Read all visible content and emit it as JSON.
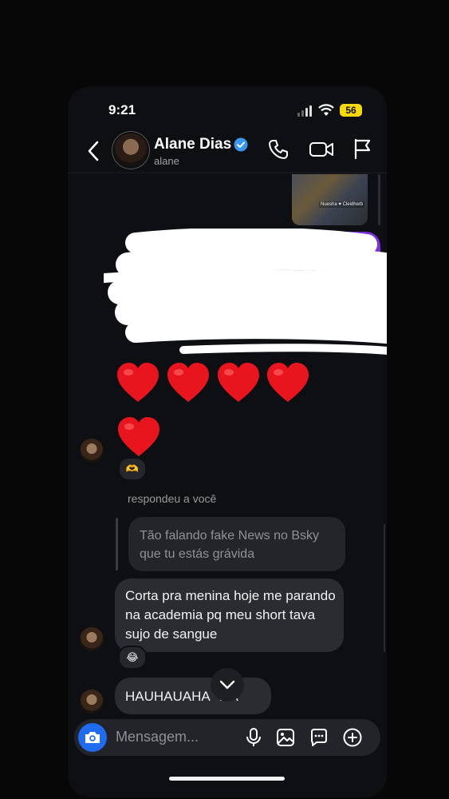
{
  "status_bar": {
    "time": "9:21",
    "battery": "56"
  },
  "header": {
    "name": "Alane Dias",
    "handle": "alane"
  },
  "media": {
    "caption": "Nuesha ♥ Cleidherb"
  },
  "hearts": [
    "❤️",
    "❤️",
    "❤️",
    "❤️",
    "❤️"
  ],
  "reactions": {
    "hearts": "🫶",
    "laugh": "😂"
  },
  "reply": {
    "label": "respondeu a você",
    "quoted": "Tão falando fake News no Bsky que tu estás grávida"
  },
  "messages": [
    {
      "text": "Corta pra menina hoje me parando na academia pq meu short tava sujo de sangue"
    },
    {
      "text": "HAUHAUAHA   AA"
    }
  ],
  "composer": {
    "placeholder": "Mensagem..."
  },
  "colors": {
    "accent_blue": "#1f6cf0",
    "purple_bubble": "#7a2ee0",
    "verified": "#3897f0",
    "battery": "#f5d90a"
  }
}
